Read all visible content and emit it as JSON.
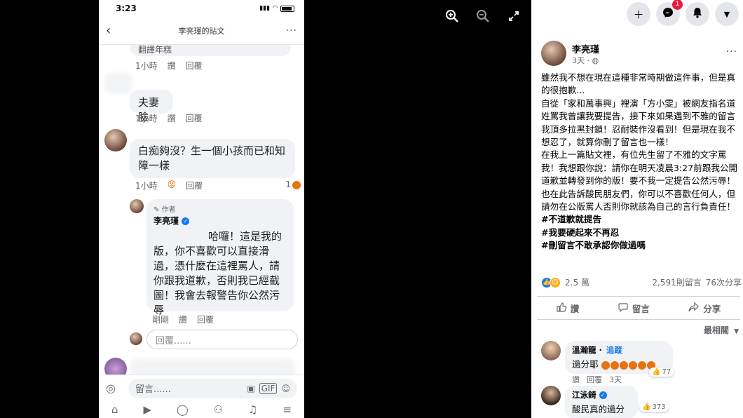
{
  "phone": {
    "status_time": "3:23",
    "header_title": "李亮瑾的貼文",
    "comments": [
      {
        "text": "翻譯年糕",
        "time": "1小時",
        "like": "讚",
        "reply": "回覆"
      },
      {
        "text": "夫妻臉",
        "time": "1小時",
        "like": "讚",
        "reply": "回覆"
      },
      {
        "text": "白痴夠沒？生一個小孩而已和知障一樣",
        "time": "1小時",
        "reply": "回覆",
        "reaction_count": "1"
      }
    ],
    "author_reply": {
      "author_tag": "作者",
      "name": "李亮瑾",
      "text": "哈囉！這是我的版，你不喜歡可以直接滑過，憑什麼在這裡罵人，請你跟我道歉，否則我已經截圖！我會去報警告你公然污辱",
      "time": "剛剛",
      "like": "讚",
      "reply": "回覆"
    },
    "reply_placeholder": "回覆......",
    "compose_placeholder": "留言......",
    "gif_label": "GIF"
  },
  "panel": {
    "notification_badge": "1",
    "post": {
      "author": "李亮瑾",
      "time": "3天",
      "paragraphs": [
        "雖然我不想在現在這種非常時期做這件事，但是真的很抱歉...",
        "自從「家和萬事興」裡演「方小雯」被網友指名道姓罵我曾讓我要提告，接下來如果遇到不雅的留言我頂多拉黑封鎖！忍耐裝作沒看到！但是現在我不想忍了，就算你刪了留言也一樣！",
        "在我上一篇貼文裡，有位先生留了不雅的文字罵我！我想跟你說：請你在明天凌晨3:27前跟我公開道歉並轉發到你的版！要不我一定提告公然污辱！",
        "也在此告訴酸民朋友們，你可以不喜歡任何人，但請勿在公版罵人否則你就該為自己的言行負責任！"
      ],
      "hashtags": [
        "#不道歉就提告",
        "#我要硬起來不再忍",
        "#刪留言不敢承認你做過嗎"
      ],
      "reaction_count": "2.5 萬",
      "comment_count": "2,591則留言",
      "share_count": "76次分享",
      "actions": {
        "like": "讚",
        "comment": "留言",
        "share": "分享"
      },
      "sort_label": "最相關"
    },
    "comments": [
      {
        "name": "溫瀚龍",
        "follow": "追蹤",
        "text": "過分耶",
        "reactions": "77",
        "like": "讚",
        "reply": "回覆",
        "time": "3天"
      },
      {
        "name": "江泳錡",
        "text": "酸民真的過分",
        "reactions": "373"
      }
    ]
  },
  "colors": {
    "facebook_blue": "#1877f2",
    "bubble_gray": "#f0f2f5",
    "meta_gray": "#65676b",
    "angry_orange": "#e9710f",
    "badge_red": "#e41e3f"
  }
}
